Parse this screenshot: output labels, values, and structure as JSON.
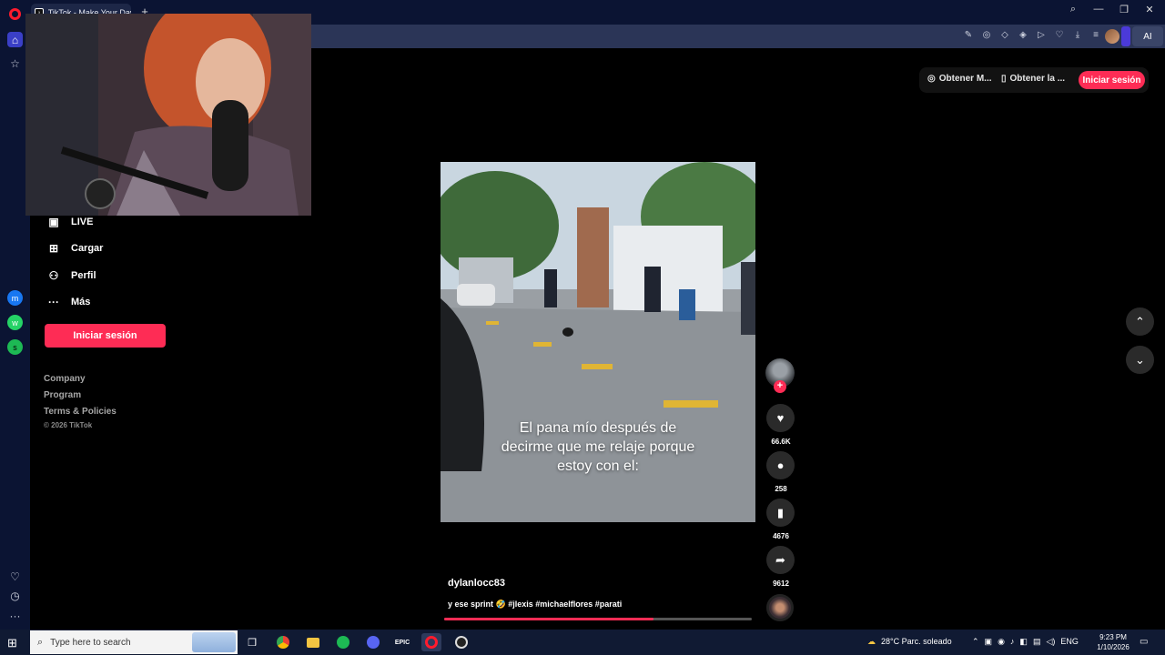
{
  "browser": {
    "tab_title": "TikTok - Make Your Day",
    "new_tab": "+",
    "ai_label": "AI",
    "window_controls": {
      "search": "⌕",
      "minimize": "—",
      "restore": "❐",
      "close": "✕"
    },
    "toolbar_icons": [
      "✎",
      "◎",
      "◇",
      "◈",
      "▷",
      "♡",
      "⤓",
      "≡"
    ]
  },
  "opera_sidebar": {
    "top": [
      "⌂",
      "☆"
    ],
    "apps": [
      "m",
      "w",
      "s"
    ],
    "bottom": [
      "♡",
      "◷",
      "···"
    ]
  },
  "tiktok_nav": {
    "items": [
      {
        "label": "LIVE",
        "icon": "▣"
      },
      {
        "label": "Cargar",
        "icon": "⊞"
      },
      {
        "label": "Perfil",
        "icon": "⚇"
      },
      {
        "label": "Más",
        "icon": "···"
      }
    ],
    "login_button": "Iniciar sesión",
    "footer_links": [
      "Company",
      "Program",
      "Terms & Policies"
    ],
    "copyright": "© 2026 TikTok"
  },
  "top_bar": {
    "get_coins": "Obtener M...",
    "get_app": "Obtener la ...",
    "login": "Iniciar sesión"
  },
  "video": {
    "caption_lines": [
      "El pana mío después de",
      "decirme que me relaje porque",
      "estoy con el:"
    ],
    "author": "dylanlocc83",
    "description": "y ese sprint 🤣 #jlexis #michaelflores #parati",
    "progress": 0.68
  },
  "actions": {
    "likes": "66.6K",
    "comments": "258",
    "saves": "4676",
    "shares": "9612",
    "follow": "+"
  },
  "scroll": {
    "up": "⌃",
    "down": "⌄"
  },
  "taskbar": {
    "search_placeholder": "Type here to search",
    "weather": "28°C  Parc. soleado",
    "language": "ENG",
    "time": "9:23 PM",
    "date": "1/10/2026"
  },
  "colors": {
    "accent": "#fe2c55",
    "chrome": "#0b1433",
    "addressbar": "#2b3557"
  }
}
